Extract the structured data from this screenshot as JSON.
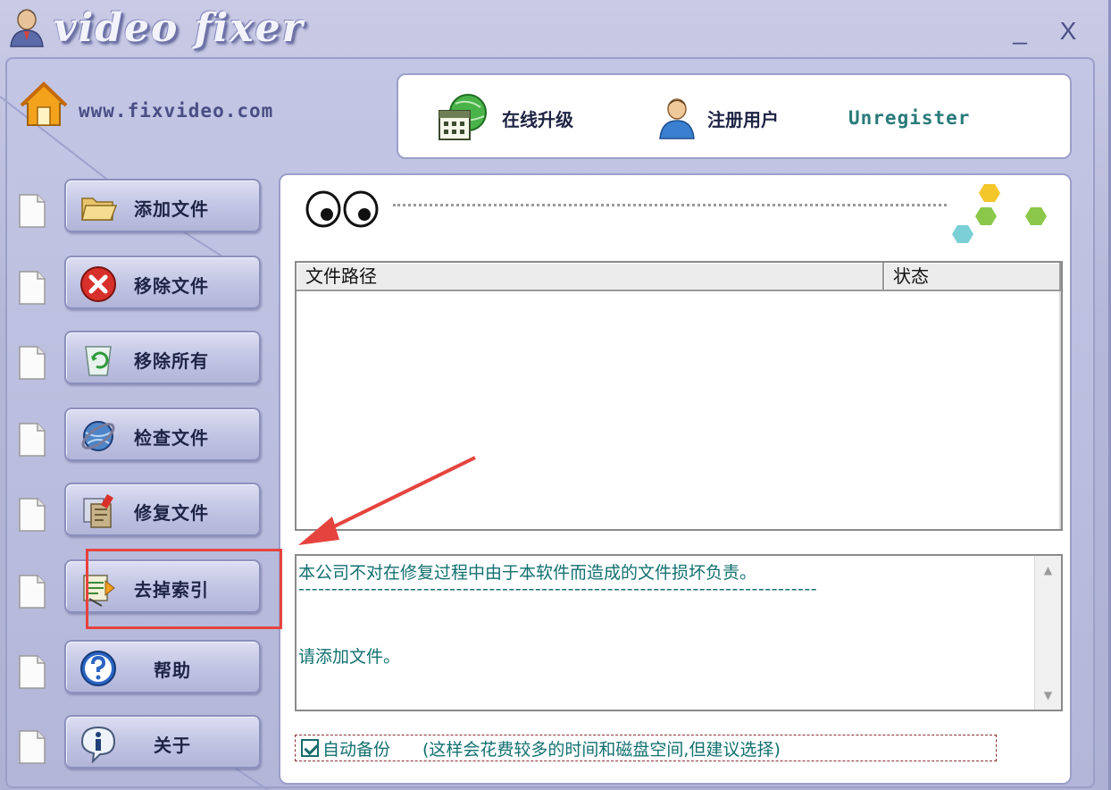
{
  "window": {
    "title": "video fixer",
    "minimize_label": "_",
    "close_label": "X"
  },
  "site_url": "www.fixvideo.com",
  "top_bar": {
    "upgrade_label": "在线升级",
    "register_label": "注册用户",
    "status_text": "Unregister"
  },
  "sidebar": {
    "items": [
      {
        "label": "添加文件",
        "icon": "folder-open-icon"
      },
      {
        "label": "移除文件",
        "icon": "red-x-icon"
      },
      {
        "label": "移除所有",
        "icon": "recycle-bin-icon"
      },
      {
        "label": "检查文件",
        "icon": "globe-check-icon"
      },
      {
        "label": "修复文件",
        "icon": "repair-files-icon"
      },
      {
        "label": "去掉索引",
        "icon": "remove-index-icon"
      },
      {
        "label": "帮助",
        "icon": "help-icon"
      },
      {
        "label": "关于",
        "icon": "info-icon"
      }
    ]
  },
  "file_table": {
    "columns": [
      "文件路径",
      "状态"
    ],
    "rows": []
  },
  "log": {
    "line1": "本公司不对在修复过程中由于本软件而造成的文件损坏负责。",
    "separator": "-------------------------------------------------------------------------------",
    "line2": "请添加文件。"
  },
  "backup": {
    "checked": true,
    "label": "自动备份",
    "note": "(这样会花费较多的时间和磁盘空间,但建议选择)"
  },
  "colors": {
    "accent_text": "#137070",
    "annotation_red": "#e5443e",
    "frame": "#b4b7d8"
  }
}
